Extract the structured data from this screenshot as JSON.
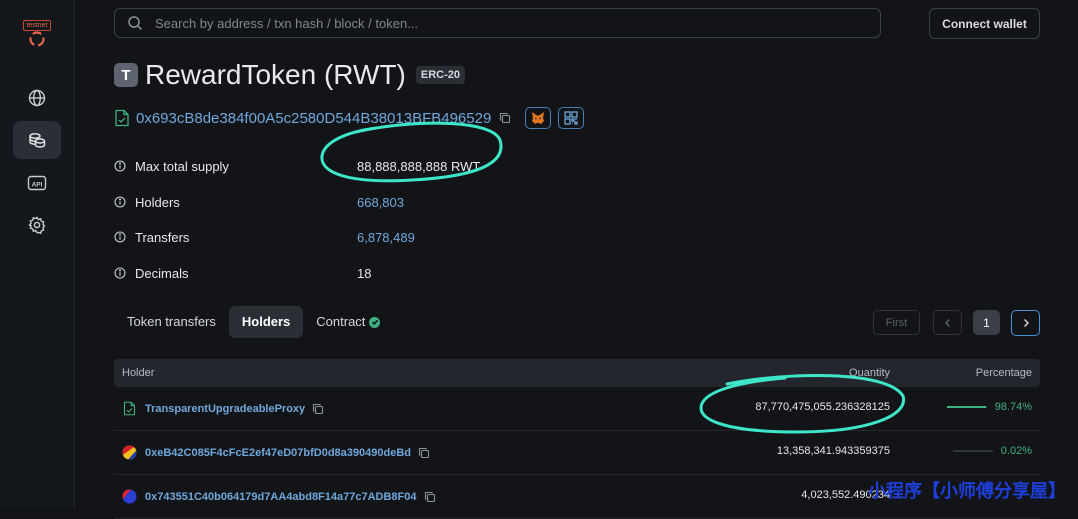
{
  "sidebar": {
    "network_badge": "testnet"
  },
  "search": {
    "placeholder": "Search by address / txn hash / block / token..."
  },
  "header": {
    "connect_label": "Connect wallet"
  },
  "token": {
    "avatar_letter": "T",
    "title": "RewardToken (RWT)",
    "standard": "ERC-20",
    "address": "0x693cB8de384f00A5c2580D544B38013BFB496529"
  },
  "info": [
    {
      "label": "Max total supply",
      "value": "88,888,888,888 RWT",
      "link": false
    },
    {
      "label": "Holders",
      "value": "668,803",
      "link": true
    },
    {
      "label": "Transfers",
      "value": "6,878,489",
      "link": true
    },
    {
      "label": "Decimals",
      "value": "18",
      "link": false
    }
  ],
  "tabs": [
    {
      "label": "Token transfers"
    },
    {
      "label": "Holders"
    },
    {
      "label": "Contract"
    }
  ],
  "pagination": {
    "first_label": "First",
    "current_page": "1"
  },
  "table": {
    "headers": {
      "holder": "Holder",
      "quantity": "Quantity",
      "percentage": "Percentage"
    },
    "rows": [
      {
        "holder": "TransparentUpgradeableProxy",
        "quantity": "87,770,475,055.236328125",
        "percentage": "98.74%",
        "share": 0.9874,
        "icon": "contract-icon"
      },
      {
        "holder": "0xeB42C085F4cFcE2ef47eD07bfD0d8a390490deBd",
        "quantity": "13,358,341.943359375",
        "percentage": "0.02%",
        "share": 0.0002,
        "icon": "identicon-icon"
      },
      {
        "holder": "0x743551C40b064179d7AA4abd8F14a77c7ADB8F04",
        "quantity": "4,023,552.490234",
        "percentage": "",
        "share": 0,
        "icon": "identicon-icon"
      }
    ]
  },
  "watermark": "小程序【小师傅分享屋】",
  "colors": {
    "accent": "#6fa8dc",
    "success": "#3fb27f",
    "highlight_ring": "#3ee6c9"
  }
}
